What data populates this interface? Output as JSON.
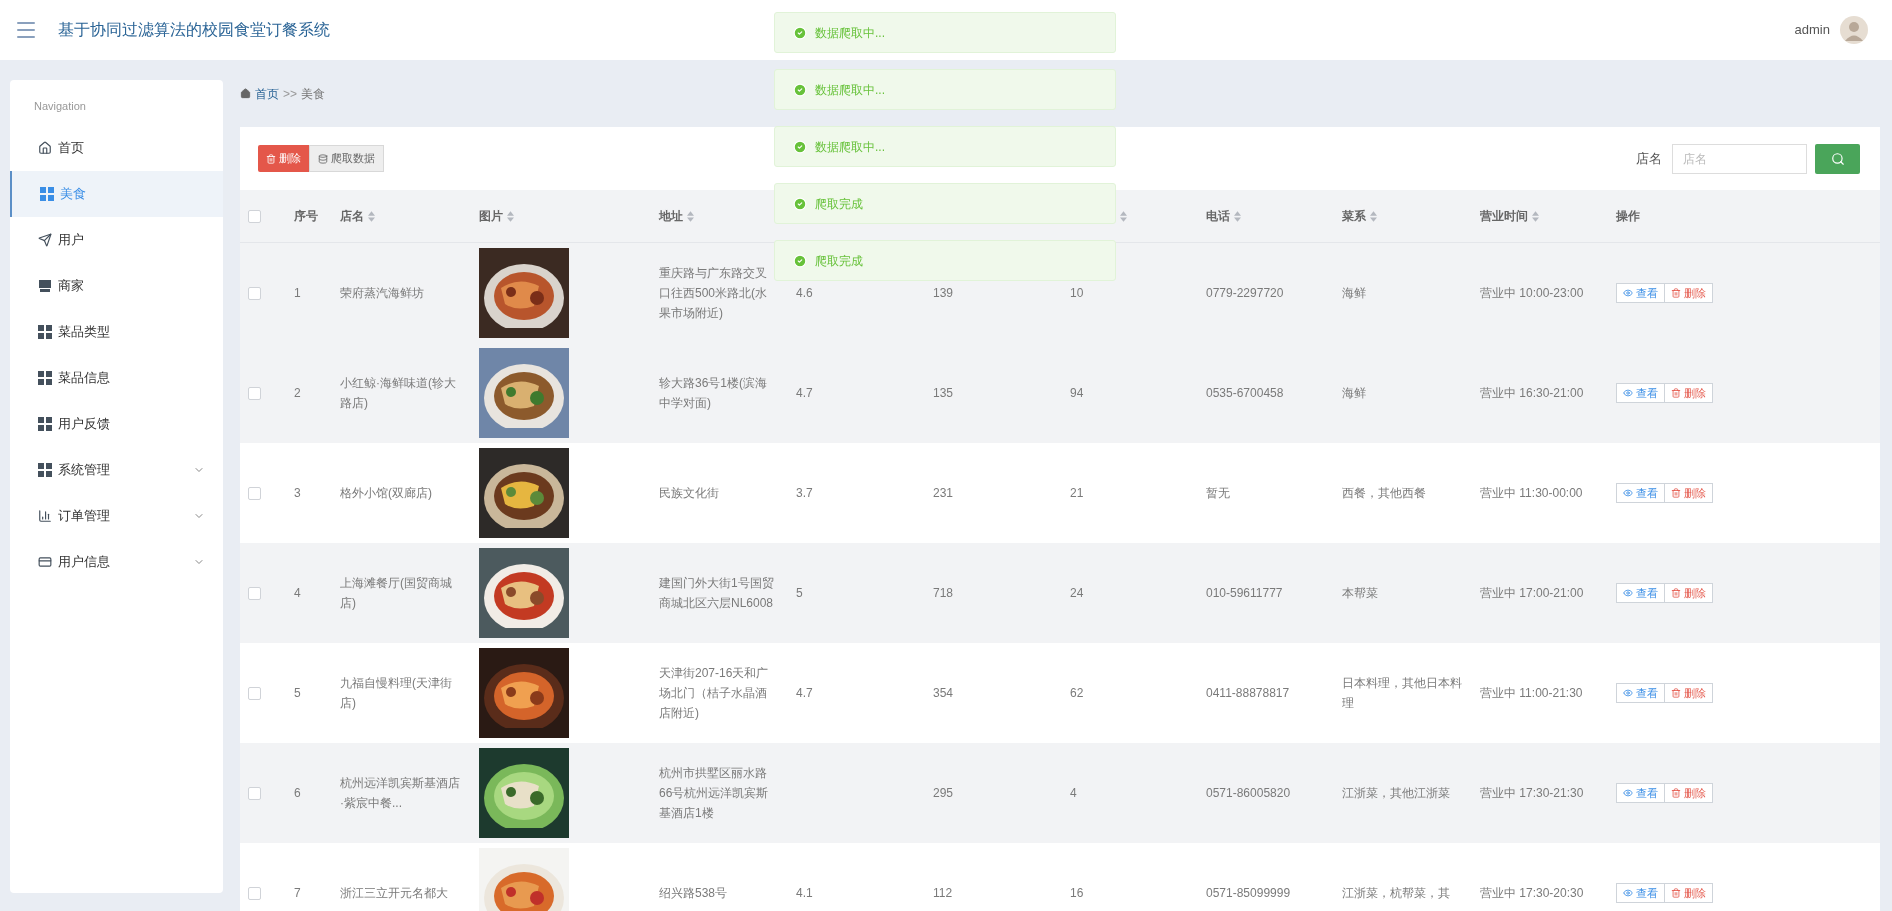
{
  "header": {
    "title": "基于协同过滤算法的校园食堂订餐系统",
    "user": "admin"
  },
  "sidebar": {
    "heading": "Navigation",
    "items": [
      {
        "label": "首页",
        "selected": false,
        "expandable": false
      },
      {
        "label": "美食",
        "selected": true,
        "expandable": false
      },
      {
        "label": "用户",
        "selected": false,
        "expandable": false
      },
      {
        "label": "商家",
        "selected": false,
        "expandable": false
      },
      {
        "label": "菜品类型",
        "selected": false,
        "expandable": false
      },
      {
        "label": "菜品信息",
        "selected": false,
        "expandable": false
      },
      {
        "label": "用户反馈",
        "selected": false,
        "expandable": false
      },
      {
        "label": "系统管理",
        "selected": false,
        "expandable": true
      },
      {
        "label": "订单管理",
        "selected": false,
        "expandable": true
      },
      {
        "label": "用户信息",
        "selected": false,
        "expandable": true
      }
    ]
  },
  "breadcrumb": {
    "home": "首页",
    "separator": ">>",
    "current": "美食"
  },
  "toolbar": {
    "delete": "删除",
    "crawl": "爬取数据"
  },
  "search": {
    "label": "店名",
    "placeholder": "店名"
  },
  "table": {
    "all_checked": false,
    "columns": [
      {
        "label": "序号",
        "sortable": false
      },
      {
        "label": "店名",
        "sortable": true
      },
      {
        "label": "图片",
        "sortable": true
      },
      {
        "label": "地址",
        "sortable": true
      },
      {},
      {},
      {
        "sortable": true
      },
      {
        "label": "电话",
        "sortable": true
      },
      {
        "label": "菜系",
        "sortable": true
      },
      {
        "label": "营业时间",
        "sortable": true
      },
      {
        "label": "操作",
        "sortable": false
      }
    ],
    "rows": [
      {
        "checked": false,
        "shaded": true,
        "cells": [
          "1",
          "荣府蒸汽海鲜坊",
          "",
          "重庆路与广东路交叉口往西500米路北(水果市场附近)",
          "4.6",
          "139",
          "10",
          "0779-2297720",
          "海鲜",
          "营业中 10:00-23:00"
        ],
        "picture": {
          "kind": "picture"
        },
        "actions": [
          {
            "kind": "view",
            "label": "查看"
          },
          {
            "kind": "delete",
            "label": "删除"
          }
        ]
      },
      {
        "checked": false,
        "shaded": true,
        "cells": [
          "2",
          "小红鲸·海鲜味道(轸大路店)",
          "",
          "轸大路36号1楼(滨海中学对面)",
          "4.7",
          "135",
          "94",
          "0535-6700458",
          "海鲜",
          "营业中 16:30-21:00"
        ],
        "picture": {
          "kind": "picture"
        },
        "actions": [
          {
            "kind": "view",
            "label": "查看"
          },
          {
            "kind": "delete",
            "label": "删除"
          }
        ]
      },
      {
        "checked": false,
        "shaded": false,
        "cells": [
          "3",
          "格外小馆(双廊店)",
          "",
          "民族文化街",
          "3.7",
          "231",
          "21",
          "暂无",
          "西餐，其他西餐",
          "营业中 11:30-00:00"
        ],
        "picture": {
          "kind": "picture"
        },
        "actions": [
          {
            "kind": "view",
            "label": "查看"
          },
          {
            "kind": "delete",
            "label": "删除"
          }
        ]
      },
      {
        "checked": false,
        "shaded": true,
        "cells": [
          "4",
          "上海滩餐厅(国贸商城店)",
          "",
          "建国门外大街1号国贸商城北区六层NL6008",
          "5",
          "718",
          "24",
          "010-59611777",
          "本帮菜",
          "营业中 17:00-21:00"
        ],
        "picture": {
          "kind": "picture"
        },
        "actions": [
          {
            "kind": "view",
            "label": "查看"
          },
          {
            "kind": "delete",
            "label": "删除"
          }
        ]
      },
      {
        "checked": false,
        "shaded": false,
        "cells": [
          "5",
          "九福自慢料理(天津街店)",
          "",
          "天津街207-16天和广场北门（桔子水晶酒店附近)",
          "4.7",
          "354",
          "62",
          "0411-88878817",
          "日本料理，其他日本料理",
          "营业中 11:00-21:30"
        ],
        "picture": {
          "kind": "picture"
        },
        "actions": [
          {
            "kind": "view",
            "label": "查看"
          },
          {
            "kind": "delete",
            "label": "删除"
          }
        ]
      },
      {
        "checked": false,
        "shaded": true,
        "cells": [
          "6",
          "杭州远洋凯宾斯基酒店·紫宸中餐...",
          "",
          "杭州市拱墅区丽水路66号杭州远洋凯宾斯基酒店1楼",
          "",
          "295",
          "4",
          "0571-86005820",
          "江浙菜，其他江浙菜",
          "营业中 17:30-21:30"
        ],
        "picture": {
          "kind": "picture"
        },
        "actions": [
          {
            "kind": "view",
            "label": "查看"
          },
          {
            "kind": "delete",
            "label": "删除"
          }
        ]
      },
      {
        "checked": false,
        "shaded": false,
        "cells": [
          "7",
          "浙江三立开元名都大",
          "",
          "绍兴路538号",
          "4.1",
          "112",
          "16",
          "0571-85099999",
          "江浙菜，杭帮菜，其",
          "营业中 17:30-20:30"
        ],
        "picture": {
          "kind": "picture"
        },
        "actions": [
          {
            "kind": "view",
            "label": "查看"
          },
          {
            "kind": "delete",
            "label": "删除"
          }
        ]
      }
    ]
  },
  "toasts": [
    {
      "kind": "success",
      "text": "数据爬取中..."
    },
    {
      "kind": "success",
      "text": "数据爬取中..."
    },
    {
      "kind": "success",
      "text": "数据爬取中..."
    },
    {
      "kind": "success",
      "text": "爬取完成"
    },
    {
      "kind": "success",
      "text": "爬取完成"
    }
  ]
}
